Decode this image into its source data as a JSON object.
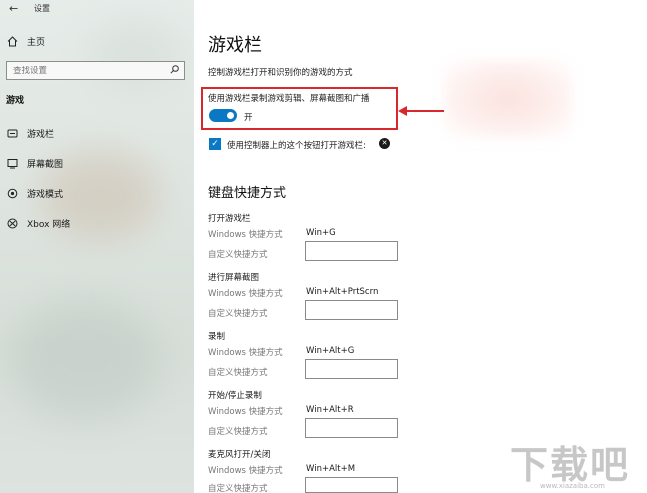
{
  "window": {
    "title": "设置",
    "back_glyph": "←"
  },
  "sidebar": {
    "home": {
      "label": "主页",
      "icon": "home-icon"
    },
    "search": {
      "placeholder": "查找设置",
      "icon": "search-icon"
    },
    "section": "游戏",
    "items": [
      {
        "label": "游戏栏",
        "icon": "game-bar-icon"
      },
      {
        "label": "屏幕截图",
        "icon": "capture-icon"
      },
      {
        "label": "游戏模式",
        "icon": "game-mode-icon"
      },
      {
        "label": "Xbox 网络",
        "icon": "xbox-icon"
      }
    ]
  },
  "main": {
    "title": "游戏栏",
    "subtitle": "控制游戏栏打开和识别你的游戏的方式",
    "record_setting": {
      "label": "使用游戏栏录制游戏剪辑、屏幕截图和广播",
      "state": "开",
      "on": true
    },
    "controller_setting": {
      "label": "使用控制器上的这个按钮打开游戏栏:",
      "checked": true
    },
    "keyboard_heading": "键盘快捷方式",
    "windows_shortcut_label": "Windows 快捷方式",
    "custom_shortcut_label": "自定义快捷方式",
    "shortcuts": [
      {
        "title": "打开游戏栏",
        "windows": "Win+G",
        "custom": ""
      },
      {
        "title": "进行屏幕截图",
        "windows": "Win+Alt+PrtScrn",
        "custom": ""
      },
      {
        "title": "录制",
        "windows": "Win+Alt+G",
        "custom": ""
      },
      {
        "title": "开始/停止录制",
        "windows": "Win+Alt+R",
        "custom": ""
      },
      {
        "title": "麦克风打开/关闭",
        "windows": "Win+Alt+M",
        "custom": ""
      }
    ]
  },
  "colors": {
    "accent": "#0a78c2",
    "annotation": "#d9272e"
  },
  "watermark": {
    "text": "下载吧",
    "sub": "www.xiazaiba.com"
  }
}
